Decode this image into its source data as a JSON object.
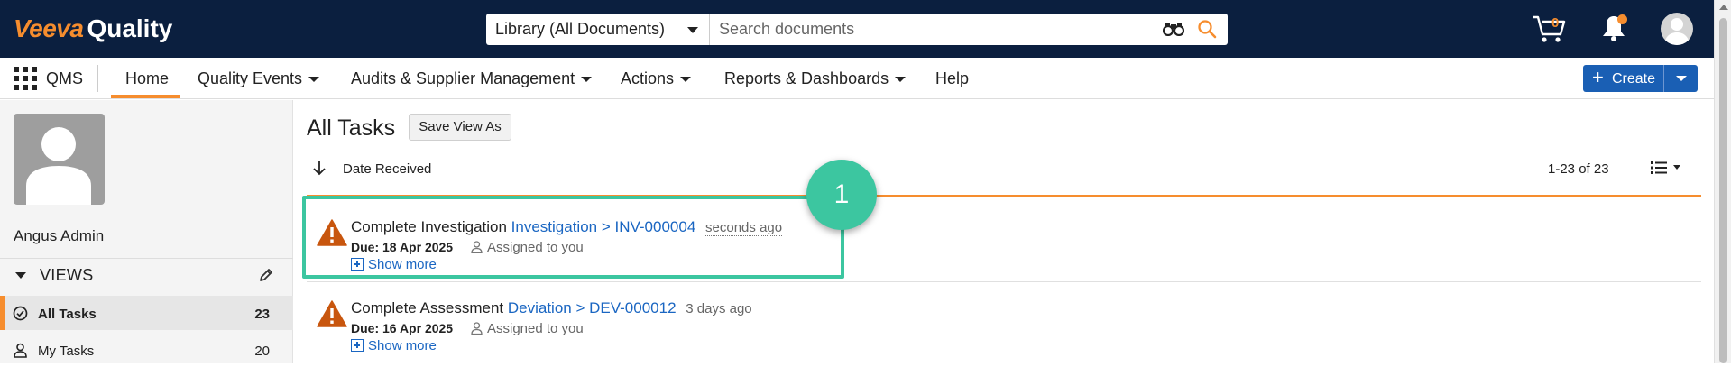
{
  "header": {
    "brand_primary": "Veeva",
    "brand_secondary": "Quality",
    "library_select": "Library (All Documents)",
    "search_placeholder": "Search documents",
    "cart_count": "0",
    "colors": {
      "bar": "#0b1f3f",
      "accent": "#f68d2e"
    }
  },
  "nav": {
    "app": "QMS",
    "items": [
      {
        "label": "Home",
        "active": true
      },
      {
        "label": "Quality Events",
        "dropdown": true
      },
      {
        "label": "Audits & Supplier Management",
        "dropdown": true
      },
      {
        "label": "Actions",
        "dropdown": true
      },
      {
        "label": "Reports & Dashboards",
        "dropdown": true
      },
      {
        "label": "Help"
      }
    ],
    "create_label": "Create"
  },
  "sidebar": {
    "user_name": "Angus Admin",
    "views_label": "VIEWS",
    "views": [
      {
        "label": "All Tasks",
        "count": "23",
        "active": true,
        "icon": "check-circle-icon"
      },
      {
        "label": "My Tasks",
        "count": "20",
        "icon": "person-icon"
      }
    ]
  },
  "main": {
    "title": "All Tasks",
    "save_view_label": "Save View As",
    "sort_label": "Date Received",
    "pager": "1-23 of 23",
    "tasks": [
      {
        "title": "Complete Investigation",
        "link": "Investigation > INV-000004",
        "ago": "seconds ago",
        "due": "Due: 18 Apr 2025",
        "assigned": "Assigned to you",
        "show_more": "Show more"
      },
      {
        "title": "Complete Assessment",
        "link": "Deviation > DEV-000012",
        "ago": "3 days ago",
        "due": "Due: 16 Apr 2025",
        "assigned": "Assigned to you",
        "show_more": "Show more"
      }
    ]
  },
  "annotation": {
    "step_number": "1",
    "color": "#3cc6a0"
  }
}
